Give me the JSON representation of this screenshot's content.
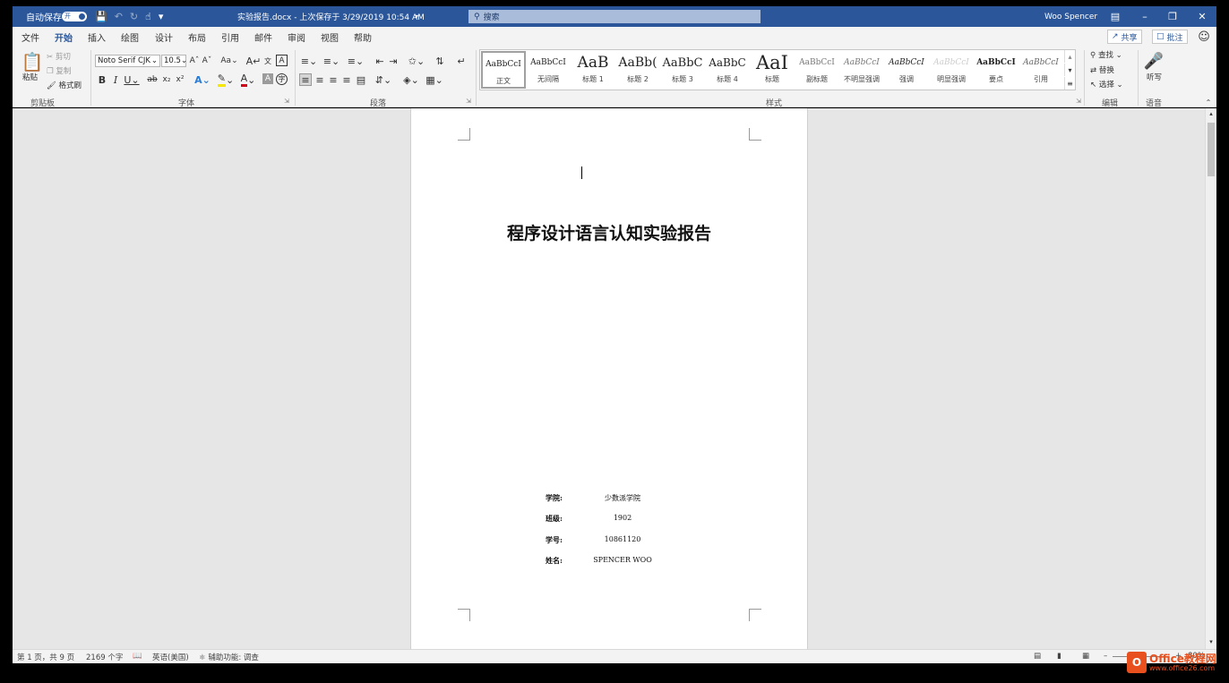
{
  "titlebar": {
    "autosave_label": "自动保存",
    "autosave_state": "开",
    "doc_title": "实验报告.docx - 上次保存于 3/29/2019 10:54 AM",
    "search_placeholder": "搜索",
    "user": "Woo Spencer"
  },
  "tabs": [
    "文件",
    "开始",
    "插入",
    "绘图",
    "设计",
    "布局",
    "引用",
    "邮件",
    "审阅",
    "视图",
    "帮助"
  ],
  "tab_actions": {
    "share": "共享",
    "comments": "批注"
  },
  "clipboard": {
    "paste": "粘贴",
    "cut": "剪切",
    "copy": "复制",
    "format_painter": "格式刷",
    "group": "剪贴板"
  },
  "font": {
    "name": "Noto Serif CJK",
    "size": "10.5",
    "group": "字体"
  },
  "paragraph": {
    "group": "段落"
  },
  "styles": {
    "group": "样式",
    "items": [
      {
        "preview": "AaBbCcI",
        "name": "正文"
      },
      {
        "preview": "AaBbCcI",
        "name": "无间隔"
      },
      {
        "preview": "AaB",
        "name": "标题 1"
      },
      {
        "preview": "AaBb(",
        "name": "标题 2"
      },
      {
        "preview": "AaBbC",
        "name": "标题 3"
      },
      {
        "preview": "AaBbC",
        "name": "标题 4"
      },
      {
        "preview": "AaI",
        "name": "标题"
      },
      {
        "preview": "AaBbCcI",
        "name": "副标题"
      },
      {
        "preview": "AaBbCcI",
        "name": "不明显强调"
      },
      {
        "preview": "AaBbCcI",
        "name": "强调"
      },
      {
        "preview": "AaBbCcI",
        "name": "明显强调"
      },
      {
        "preview": "AaBbCcI",
        "name": "要点"
      },
      {
        "preview": "AaBbCcI",
        "name": "引用"
      }
    ]
  },
  "editing": {
    "find": "查找",
    "replace": "替换",
    "select": "选择",
    "group": "编辑"
  },
  "voice": {
    "dictate": "听写",
    "group": "语音"
  },
  "document": {
    "title": "程序设计语言认知实验报告",
    "info": [
      {
        "key": "学院:",
        "value": "少数派学院"
      },
      {
        "key": "班级:",
        "value": "1902"
      },
      {
        "key": "学号:",
        "value": "10861120"
      },
      {
        "key": "姓名:",
        "value": "SPENCER WOO"
      }
    ]
  },
  "statusbar": {
    "page": "第 1 页，共 9 页",
    "words": "2169 个字",
    "language": "英语(美国)",
    "accessibility": "辅助功能: 调查",
    "zoom": "80%"
  },
  "watermark": {
    "brand": "Office教程网",
    "url": "www.office26.com"
  },
  "colors": {
    "accent": "#2b579a",
    "canvas": "#e6e6e6",
    "watermark": "#e8501d"
  }
}
